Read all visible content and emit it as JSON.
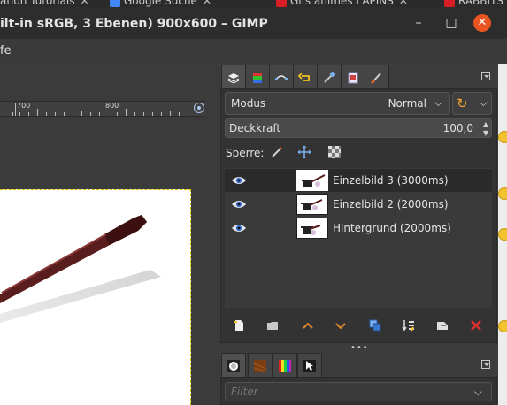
{
  "browser_tabs": [
    {
      "label": "ation Tutorials",
      "icon": "tab-icon"
    },
    {
      "label": "Google Suche",
      "icon": "google-chrome-icon"
    },
    {
      "label": "Gifs animes LAPINS",
      "icon": "red-favicon-icon"
    },
    {
      "label": "RABBITS",
      "icon": "red-favicon-icon"
    }
  ],
  "window": {
    "title": "ilt-in sRGB, 3 Ebenen) 900x600 – GIMP",
    "minimize_label": "–",
    "maximize_label": "□",
    "close_label": "✕"
  },
  "menubar": {
    "help_label": "fe"
  },
  "ruler": {
    "labels": [
      "700",
      "800"
    ]
  },
  "dock": {
    "tabs": [
      "layers-icon",
      "channels-icon",
      "paths-icon",
      "undo-history-icon",
      "tool-options-icon",
      "images-icon",
      "brushes-icon"
    ],
    "mode": {
      "label": "Modus",
      "value": "Normal"
    },
    "opacity": {
      "label": "Deckkraft",
      "value": "100,0"
    },
    "lock_label": "Sperre:",
    "layers": [
      {
        "name": "Einzelbild 3 (3000ms)",
        "selected": true
      },
      {
        "name": "Einzelbild 2 (2000ms)",
        "selected": false
      },
      {
        "name": "Hintergrund (2000ms)",
        "selected": false
      }
    ],
    "layer_buttons": [
      "new-layer-icon",
      "new-layer-group-icon",
      "raise-layer-icon",
      "lower-layer-icon",
      "duplicate-layer-icon",
      "merge-down-icon",
      "anchor-layer-icon",
      "delete-layer-icon"
    ],
    "lower_tabs": [
      "brushes-icon",
      "patterns-icon",
      "gradients-icon",
      "pointer-icon"
    ],
    "filter": {
      "placeholder": "Filter"
    }
  },
  "colors": {
    "accent_close": "#e95420",
    "selection_border": "#d4c000",
    "delete_icon": "#d73030",
    "arrow_icon": "#e0892a"
  }
}
